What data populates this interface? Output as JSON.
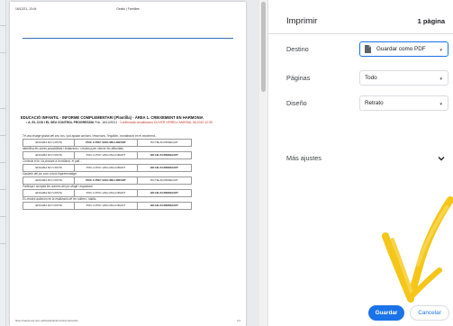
{
  "preview": {
    "header_left": "16/12/21, 13:44",
    "header_center": "Gestió | Famílies",
    "doc_title": "EDUCACIÓ INFANTIL - INFORME COMPLEMENTARI (Plantilla) - ÀREA 1. CREIXEMENT EN HARMONIA",
    "sub_bullet": "A. EL COS I EL SEU CONTROL PROGRESSIU",
    "sub_pub": "Pub. 16/12/2021",
    "sub_confirm": "· Confirmada visualització OLIVER VIRRELL MARSAL 06-2022 12:35",
    "options": [
      "ENCARA NO COSTA",
      "POC A POC VAIG MILLORANT",
      "HO HE ACONSEGUIT"
    ],
    "questions": [
      {
        "text": "Té una imatge global del seu cos i pot ajustar accions i reaccions, l'equilibri, coordinació en el moviment...",
        "selected": 1
      },
      {
        "text": "Identifica les seves possibilitats i limitacions i s'esforça per vèncer les dificultats.",
        "selected": 2
      },
      {
        "text": "Controla el to i la postura a la rotllana, el pati...",
        "selected": 2
      },
      {
        "text": "Gaudeix del joc com a font d'aprenentatge.",
        "selected": 1
      },
      {
        "text": "Participa i accepta les normes del joc dirigit i espontani.",
        "selected": 2
      },
      {
        "text": "Es mostra autònom en la realització de les rutines i hàbits.",
        "selected": 2
      }
    ],
    "footer_url": "https://nauctl.edu.xtec.cat/familieslinform/informeFamilia",
    "footer_page": "1/1"
  },
  "panel": {
    "title": "Imprimir",
    "pages_count": "1 pàgina",
    "destination_label": "Destino",
    "destination_value": "Guardar como PDF",
    "pages_label": "Páginas",
    "pages_value": "Todo",
    "layout_label": "Diseño",
    "layout_value": "Retrato",
    "more_settings": "Más ajustes",
    "save_label": "Guardar",
    "cancel_label": "Cancelar"
  },
  "colors": {
    "accent": "#1a73e8",
    "overlay_arrow": "#f5c518"
  },
  "icons": [
    "file-icon",
    "chevron-down-icon",
    "caret-down-icon"
  ]
}
